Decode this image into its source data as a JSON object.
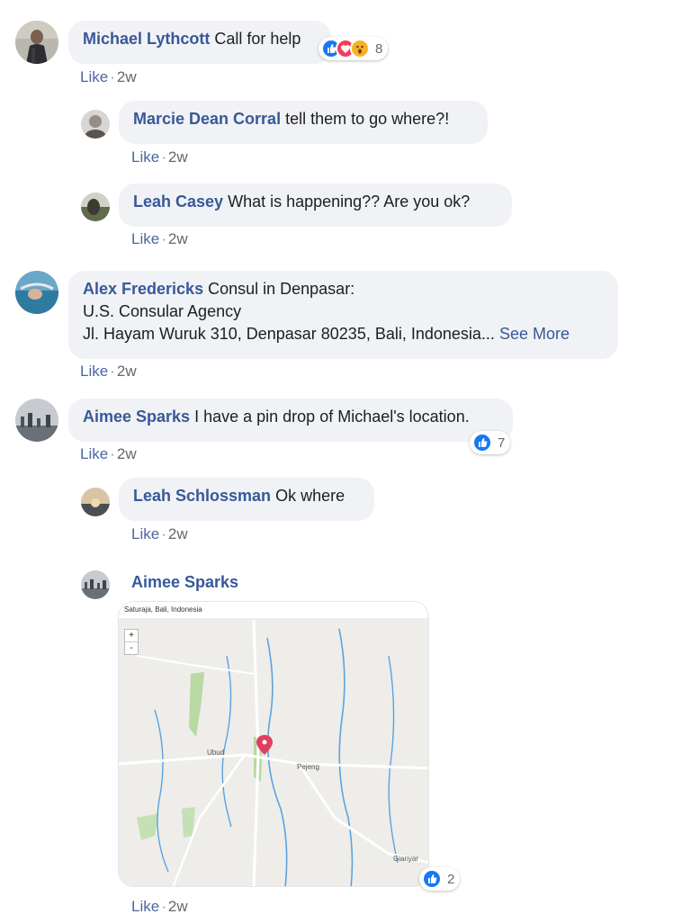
{
  "colors": {
    "name": "#385898",
    "bubble": "#f0f2f5",
    "like_blue": "#1877f2",
    "love_red": "#f33e58",
    "wow_yellow": "#f7b125"
  },
  "comments": [
    {
      "name": "Michael Lythcott",
      "text": "Call for help",
      "like": "Like",
      "time": "2w",
      "reactions": {
        "count": "8",
        "types": [
          "like-reaction-icon",
          "love-reaction-icon",
          "wow-reaction-icon"
        ]
      }
    },
    {
      "name": "Marcie Dean Corral",
      "text": "tell them to go where?!",
      "like": "Like",
      "time": "2w"
    },
    {
      "name": "Leah Casey",
      "text": "What is happening?? Are you ok?",
      "like": "Like",
      "time": "2w"
    },
    {
      "name": "Alex Fredericks",
      "lines": [
        "Consul in Denpasar:",
        "U.S. Consular Agency",
        "Jl. Hayam Wuruk 310, Denpasar 80235, Bali, Indonesia..."
      ],
      "see_more": "See More",
      "like": "Like",
      "time": "2w"
    },
    {
      "name": "Aimee Sparks",
      "text": "I have a pin drop of Michael's location.",
      "like": "Like",
      "time": "2w",
      "reactions": {
        "count": "7",
        "types": [
          "like-reaction-icon"
        ]
      }
    },
    {
      "name": "Leah Schlossman",
      "text": "Ok where",
      "like": "Like",
      "time": "2w"
    },
    {
      "name": "Aimee Sparks",
      "like": "Like",
      "time": "2w",
      "reactions": {
        "count": "2",
        "types": [
          "like-reaction-icon"
        ]
      },
      "map": {
        "header": "Saturaja, Bali, Indonesia",
        "zoom_in": "+",
        "zoom_out": "-",
        "labels": {
          "ubud": "Ubud",
          "pejeng": "Pejeng",
          "gianyar": "Gianyar"
        }
      }
    }
  ]
}
